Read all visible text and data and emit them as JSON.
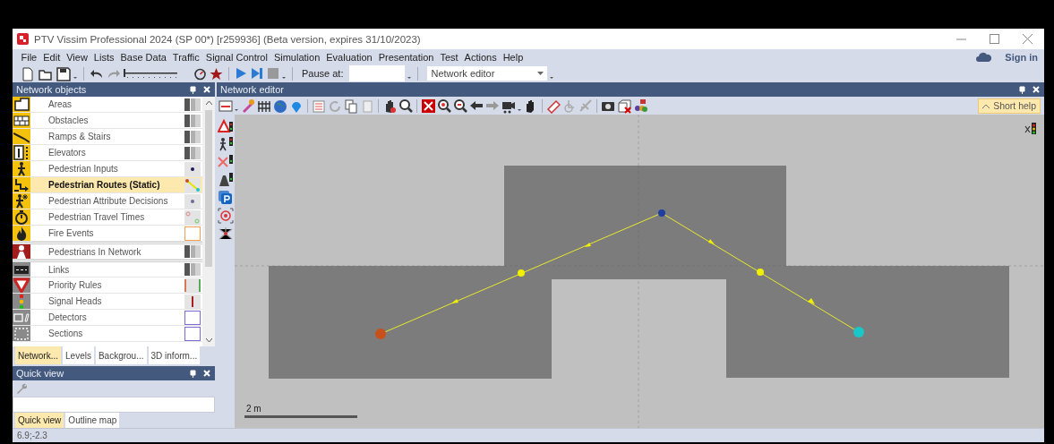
{
  "window": {
    "title": "PTV Vissim Professional 2024 (SP 00*) [r259936] (Beta version, expires 31/10/2023)"
  },
  "menu": [
    "File",
    "Edit",
    "View",
    "Lists",
    "Base Data",
    "Traffic",
    "Signal Control",
    "Simulation",
    "Evaluation",
    "Presentation",
    "Test",
    "Actions",
    "Help"
  ],
  "account": {
    "label": "Sign in"
  },
  "toolbar": {
    "speed_slider": {
      "level": 0
    },
    "pause_label": "Pause at:",
    "view_dropdown": "Network editor"
  },
  "network_objects": {
    "title": "Network objects",
    "items": [
      {
        "label": "Areas",
        "kind": "areas",
        "selected": false
      },
      {
        "label": "Obstacles",
        "kind": "obstacles",
        "selected": false
      },
      {
        "label": "Ramps & Stairs",
        "kind": "ramps",
        "selected": false
      },
      {
        "label": "Elevators",
        "kind": "elevators",
        "selected": false
      },
      {
        "label": "Pedestrian Inputs",
        "kind": "inputs",
        "selected": false
      },
      {
        "label": "Pedestrian Routes (Static)",
        "kind": "routes",
        "selected": true
      },
      {
        "label": "Pedestrian Attribute Decisions",
        "kind": "decisions",
        "selected": false
      },
      {
        "label": "Pedestrian Travel Times",
        "kind": "traveltimes",
        "selected": false
      },
      {
        "label": "Fire Events",
        "kind": "fire",
        "selected": false
      },
      {
        "label": "Pedestrians In Network",
        "kind": "pedestrians",
        "selected": false
      },
      {
        "label": "Links",
        "kind": "links",
        "selected": false
      },
      {
        "label": "Priority Rules",
        "kind": "priority",
        "selected": false
      },
      {
        "label": "Signal Heads",
        "kind": "signals",
        "selected": false
      },
      {
        "label": "Detectors",
        "kind": "detectors",
        "selected": false
      },
      {
        "label": "Sections",
        "kind": "sections",
        "selected": false
      }
    ],
    "tabs": [
      {
        "label": "Network...",
        "selected": true
      },
      {
        "label": "Levels",
        "selected": false
      },
      {
        "label": "Backgrou...",
        "selected": false
      },
      {
        "label": "3D inform...",
        "selected": false
      }
    ]
  },
  "quick_view": {
    "title": "Quick view",
    "tabs": [
      {
        "label": "Quick view",
        "selected": true
      },
      {
        "label": "Outline map",
        "selected": false
      }
    ]
  },
  "network_editor": {
    "title": "Network editor",
    "short_help": "Short help",
    "scale_label": "2 m"
  },
  "status_bar": {
    "coordinates": "6.9;-2.3"
  }
}
